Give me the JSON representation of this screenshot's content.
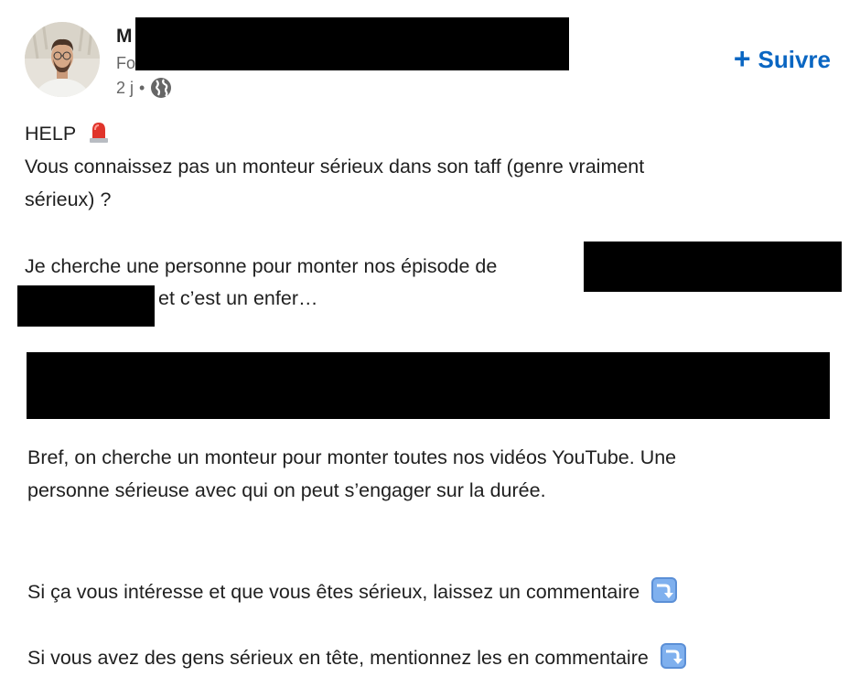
{
  "author": {
    "name_visible": "M",
    "headline_visible": "Fo",
    "post_age": "2 j",
    "separator": "•",
    "visibility_icon": "globe-icon"
  },
  "actions": {
    "follow_label": "Suivre",
    "follow_icon": "plus-icon"
  },
  "post": {
    "lines": [
      "HELP",
      "Vous connaissez pas un monteur sérieux dans son taff (genre vraiment",
      "sérieux) ?",
      "Je cherche une personne pour monter nos épisode de",
      "et c’est un enfer…",
      "Bref, on cherche un monteur pour monter toutes nos vidéos YouTube. Une",
      "personne sérieuse avec qui on peut s’engager sur la durée.",
      "Si ça vous intéresse et que vous êtes sérieux, laissez un commentaire",
      "Si vous avez des gens sérieux en tête, mentionnez les en commentaire"
    ],
    "emojis": {
      "help": "police-light-icon",
      "arrow": "arrow-right-curving-down-icon"
    }
  },
  "colors": {
    "accent": "#0a66c2",
    "text": "#1f1f1f",
    "muted": "#666666",
    "redaction": "#000000"
  }
}
